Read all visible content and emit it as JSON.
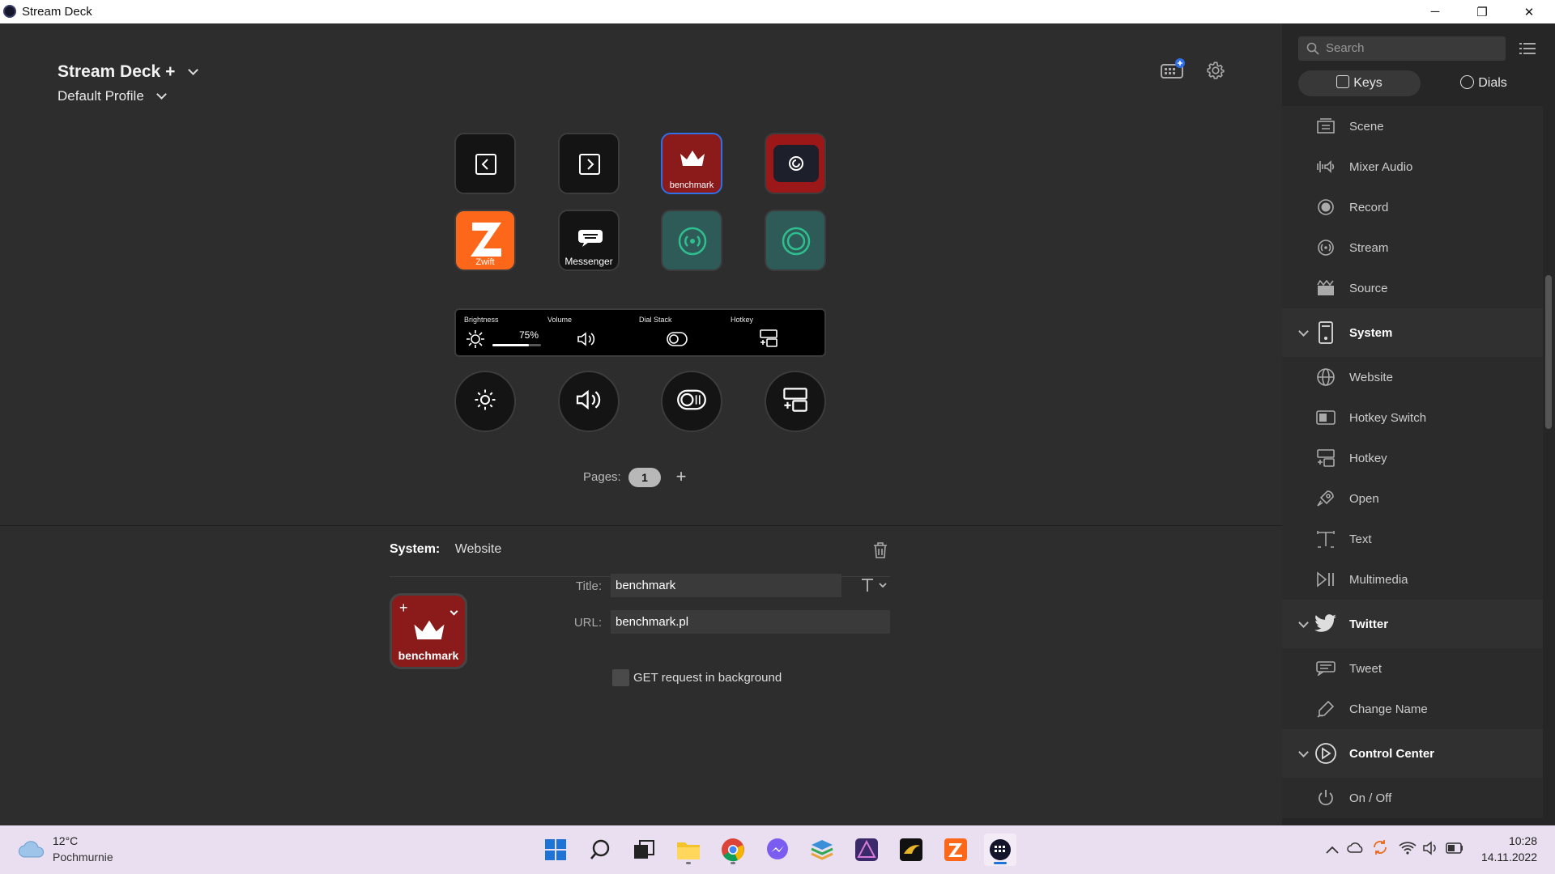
{
  "window": {
    "title": "Stream Deck",
    "minimize": "─",
    "restore": "❐",
    "close": "✕"
  },
  "header": {
    "device_name": "Stream Deck +",
    "profile": "Default Profile"
  },
  "keys": [
    {
      "label": "",
      "icon": "previous-page-icon"
    },
    {
      "label": "",
      "icon": "next-page-icon"
    },
    {
      "label": "benchmark",
      "icon": "crown-icon",
      "selected": true
    },
    {
      "label": "",
      "icon": "elgato-icon"
    },
    {
      "label": "Zwift",
      "icon": "zwift-icon"
    },
    {
      "label": "Messenger",
      "icon": "messenger-icon"
    },
    {
      "label": "",
      "icon": "stream-icon"
    },
    {
      "label": "",
      "icon": "record-icon"
    }
  ],
  "touch_strip": {
    "brightness": {
      "title": "Brightness",
      "value": "75%",
      "level": 0.75
    },
    "volume": {
      "title": "Volume"
    },
    "dial_stack": {
      "title": "Dial Stack"
    },
    "hotkey": {
      "title": "Hotkey"
    }
  },
  "dials": [
    "brightness-dial-icon",
    "volume-dial-icon",
    "dial-stack-icon",
    "hotkey-dial-icon"
  ],
  "pages": {
    "label": "Pages:",
    "current": "1",
    "add": "+"
  },
  "inspector": {
    "category": "System:",
    "action": "Website",
    "key_preview_label": "benchmark",
    "title_label": "Title:",
    "title_value": "benchmark",
    "url_label": "URL:",
    "url_value": "benchmark.pl",
    "get_request_label": "GET request in background"
  },
  "sidebar": {
    "search_placeholder": "Search",
    "tab_keys": "Keys",
    "tab_dials": "Dials",
    "items_top": [
      "Scene",
      "Mixer Audio",
      "Record",
      "Stream",
      "Source"
    ],
    "group_system": "System",
    "items_system": [
      "Website",
      "Hotkey Switch",
      "Hotkey",
      "Open",
      "Text",
      "Multimedia"
    ],
    "group_twitter": "Twitter",
    "items_twitter": [
      "Tweet",
      "Change Name"
    ],
    "group_control": "Control Center",
    "items_control": [
      "On / Off"
    ]
  },
  "taskbar": {
    "weather_temp": "12°C",
    "weather_desc": "Pochmurnie",
    "time": "10:28",
    "date": "14.11.2022"
  },
  "colors": {
    "accent_blue": "#2f6fe8",
    "key_red": "#8b1a1a",
    "zwift_orange": "#fc6719",
    "teal": "#2fbf8f"
  }
}
